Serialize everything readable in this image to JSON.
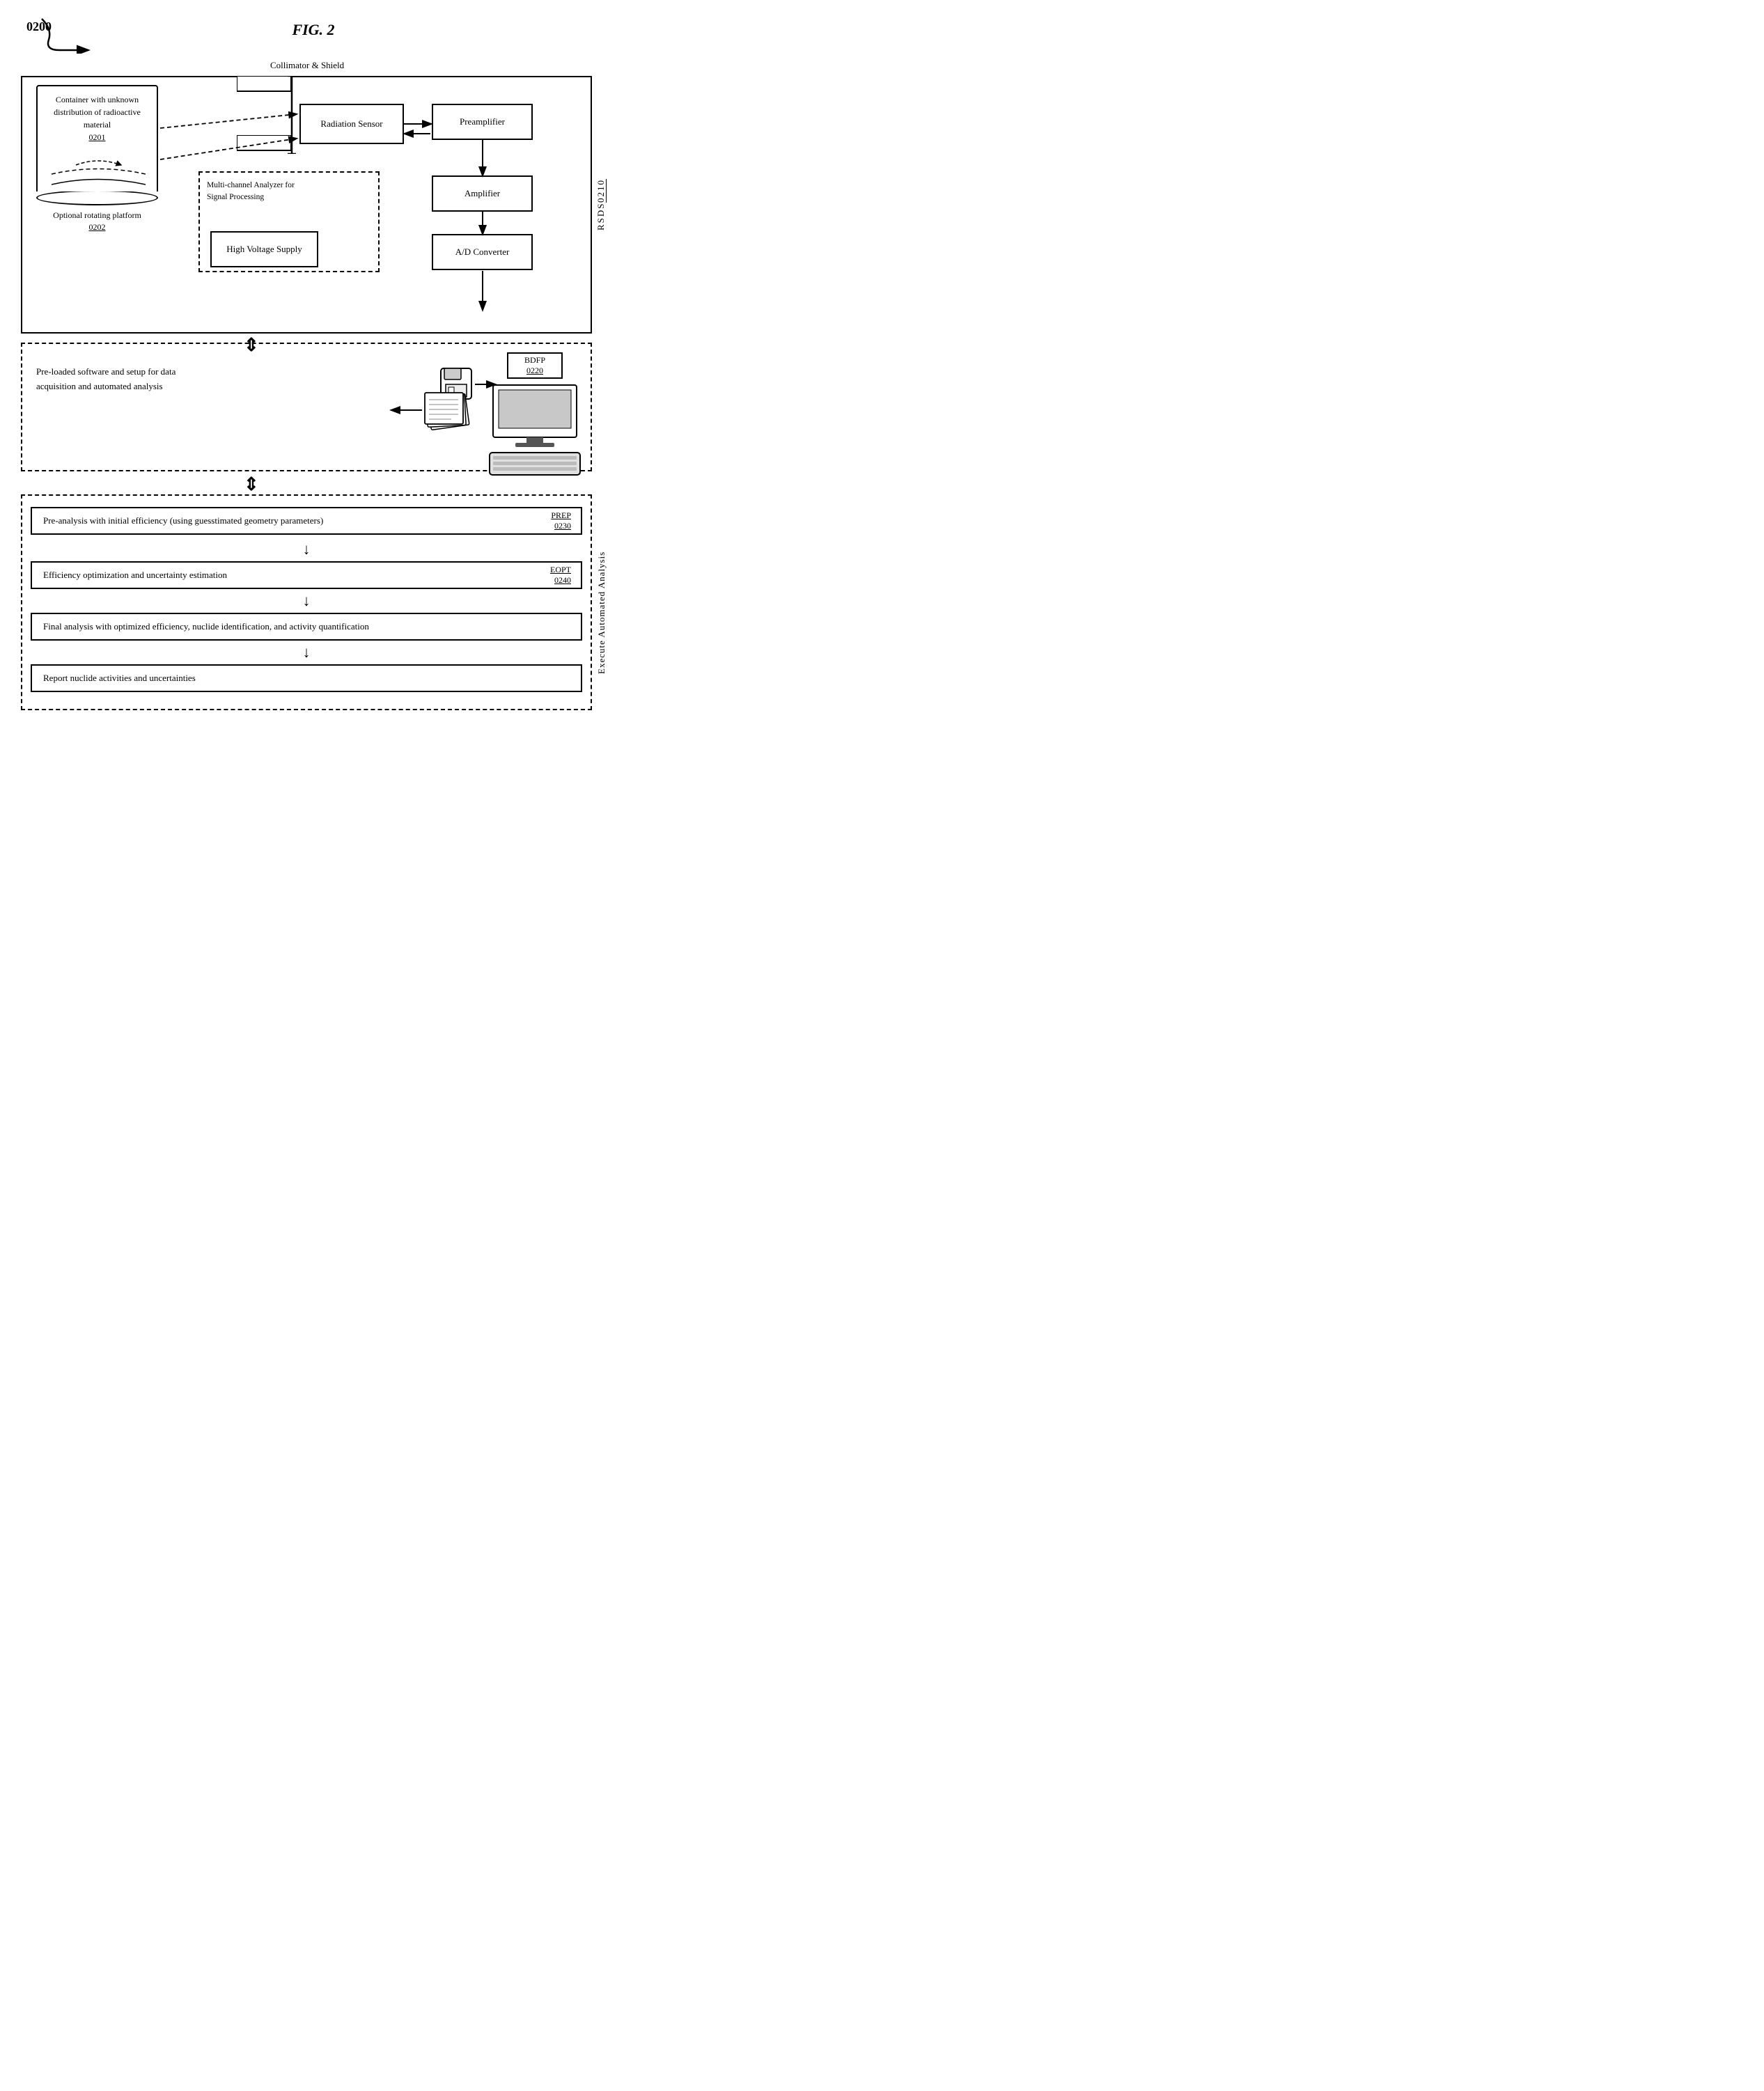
{
  "figure": {
    "title": "FIG. 2",
    "ref_number": "0200"
  },
  "rsds": {
    "label": "RSDS 0210",
    "collimator_label": "Collimator & Shield"
  },
  "container": {
    "text": "Container with unknown distribution of radioactive material",
    "label": "0201",
    "rotating_text": "Optional rotating platform",
    "rotating_label": "0202"
  },
  "components": {
    "radiation_sensor": "Radiation Sensor",
    "preamplifier": "Preamplifier",
    "amplifier": "Amplifier",
    "adc": "A/D Converter",
    "hvs": "High Voltage Supply",
    "mca_label": "Multi-channel Analyzer for Signal Processing"
  },
  "bdfp": {
    "text": "Pre-loaded software and setup for data acquisition and automated analysis",
    "monitor_label": "BDFP",
    "monitor_ref": "0220"
  },
  "analysis": {
    "label": "Execute Automated Analysis",
    "step1_text": "Pre-analysis with initial efficiency (using guesstimated geometry parameters)",
    "step1_label": "PREP",
    "step1_ref": "0230",
    "step2_text": "Efficiency optimization and uncertainty estimation",
    "step2_label": "EOPT",
    "step2_ref": "0240",
    "step3_text": "Final analysis with optimized efficiency, nuclide identification, and activity quantification",
    "step4_text": "Report nuclide activities and uncertainties"
  }
}
